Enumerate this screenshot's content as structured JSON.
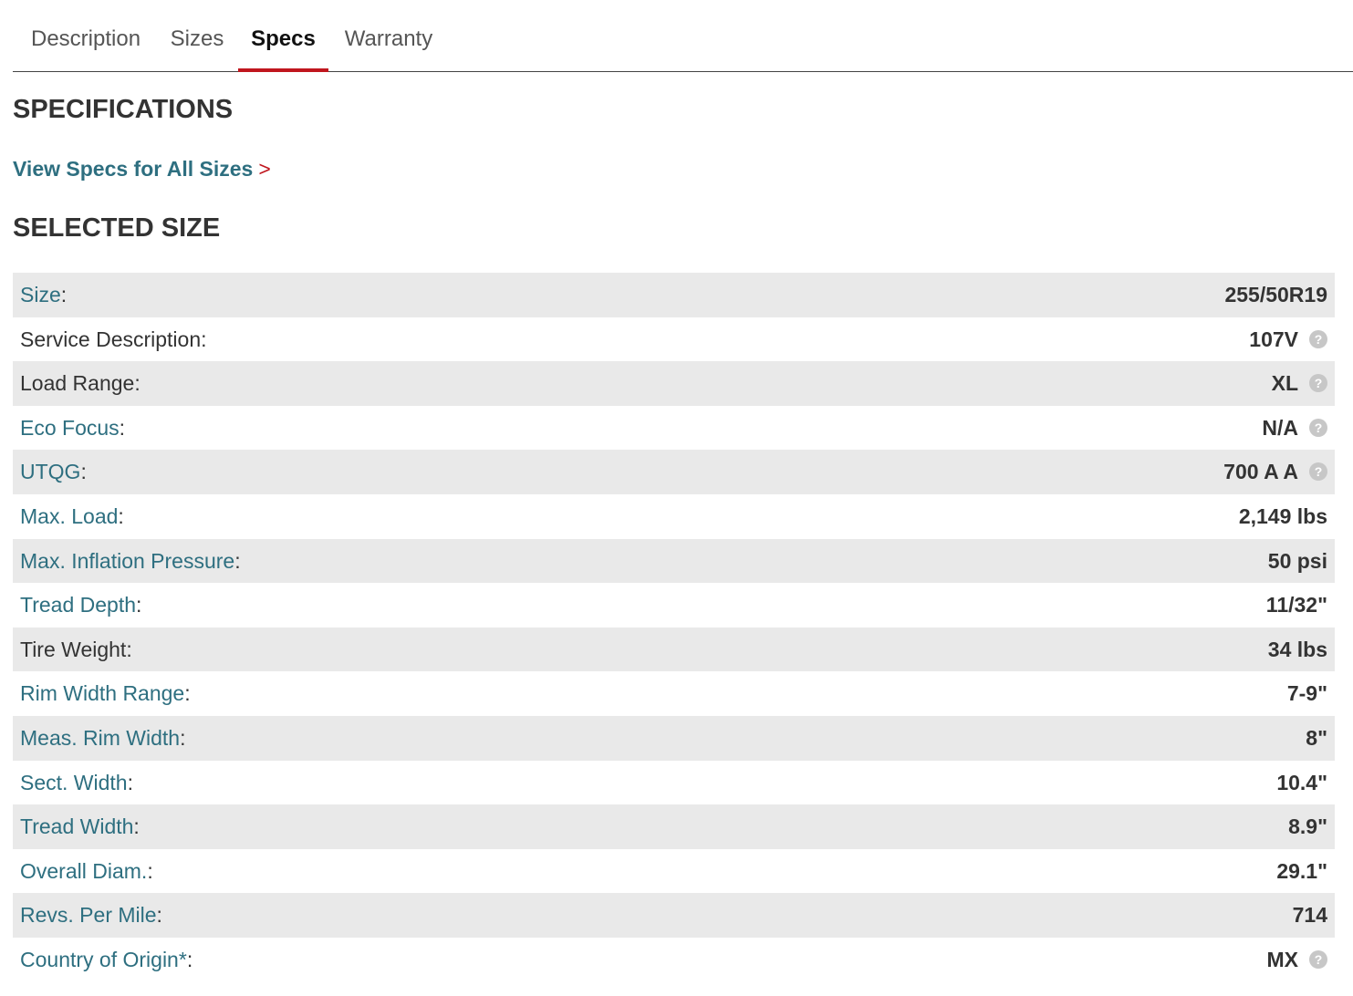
{
  "tabs": [
    {
      "label": "Description",
      "active": false
    },
    {
      "label": "Sizes",
      "active": false
    },
    {
      "label": "Specs",
      "active": true
    },
    {
      "label": "Warranty",
      "active": false
    }
  ],
  "specifications_heading": "SPECIFICATIONS",
  "view_all_link": {
    "label": "View Specs for All Sizes",
    "arrow": ">"
  },
  "selected_size_heading": "SELECTED SIZE",
  "colors": {
    "accent_red": "#c0161e",
    "link_teal": "#2e6f80",
    "row_shade": "#e9e9e9"
  },
  "help_icon_glyph": "?",
  "specs": [
    {
      "label": "Size",
      "value": "255/50R19",
      "link": true,
      "help": false
    },
    {
      "label": "Service Description",
      "value": "107V",
      "link": false,
      "help": true
    },
    {
      "label": "Load Range",
      "value": "XL",
      "link": false,
      "help": true
    },
    {
      "label": "Eco Focus",
      "value": "N/A",
      "link": true,
      "help": true
    },
    {
      "label": "UTQG",
      "value": "700 A A",
      "link": true,
      "help": true
    },
    {
      "label": "Max. Load",
      "value": "2,149 lbs",
      "link": true,
      "help": false
    },
    {
      "label": "Max. Inflation Pressure",
      "value": "50 psi",
      "link": true,
      "help": false
    },
    {
      "label": "Tread Depth",
      "value": "11/32\"",
      "link": true,
      "help": false
    },
    {
      "label": "Tire Weight",
      "value": "34 lbs",
      "link": false,
      "help": false
    },
    {
      "label": "Rim Width Range",
      "value": "7-9\"",
      "link": true,
      "help": false
    },
    {
      "label": "Meas. Rim Width",
      "value": "8\"",
      "link": true,
      "help": false
    },
    {
      "label": "Sect. Width",
      "value": "10.4\"",
      "link": true,
      "help": false
    },
    {
      "label": "Tread Width",
      "value": "8.9\"",
      "link": true,
      "help": false
    },
    {
      "label": "Overall Diam.",
      "value": "29.1\"",
      "link": true,
      "help": false
    },
    {
      "label": "Revs. Per Mile",
      "value": "714",
      "link": true,
      "help": false
    },
    {
      "label": "Country of Origin*",
      "value": "MX",
      "link": true,
      "help": true
    }
  ]
}
